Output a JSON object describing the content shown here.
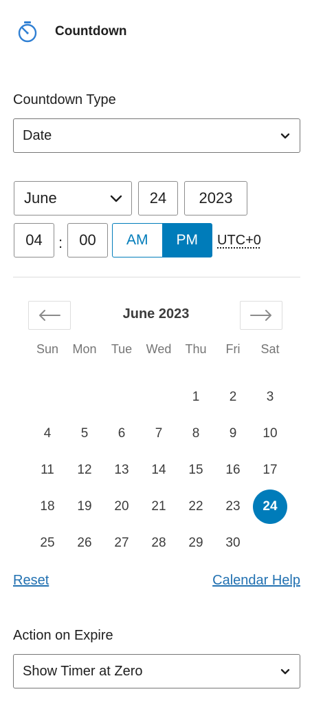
{
  "header": {
    "title": "Countdown",
    "icon": "timer-icon",
    "icon_color": "#2f7fd3"
  },
  "countdown_type": {
    "label": "Countdown Type",
    "value": "Date"
  },
  "date": {
    "month": "June",
    "day": "24",
    "year": "2023"
  },
  "time": {
    "hours": "04",
    "separator": ":",
    "minutes": "00",
    "am_label": "AM",
    "pm_label": "PM",
    "selected": "PM",
    "timezone": "UTC+0"
  },
  "calendar": {
    "title": "June 2023",
    "weekdays": [
      "Sun",
      "Mon",
      "Tue",
      "Wed",
      "Thu",
      "Fri",
      "Sat"
    ],
    "weeks": [
      [
        "",
        "",
        "",
        "",
        "1",
        "2",
        "3"
      ],
      [
        "4",
        "5",
        "6",
        "7",
        "8",
        "9",
        "10"
      ],
      [
        "11",
        "12",
        "13",
        "14",
        "15",
        "16",
        "17"
      ],
      [
        "18",
        "19",
        "20",
        "21",
        "22",
        "23",
        "24"
      ],
      [
        "25",
        "26",
        "27",
        "28",
        "29",
        "30",
        ""
      ]
    ],
    "selected_day": "24",
    "accent_color": "#007cba"
  },
  "links": {
    "reset": "Reset",
    "help": "Calendar Help"
  },
  "action_on_expire": {
    "label": "Action on Expire",
    "value": "Show Timer at Zero"
  }
}
